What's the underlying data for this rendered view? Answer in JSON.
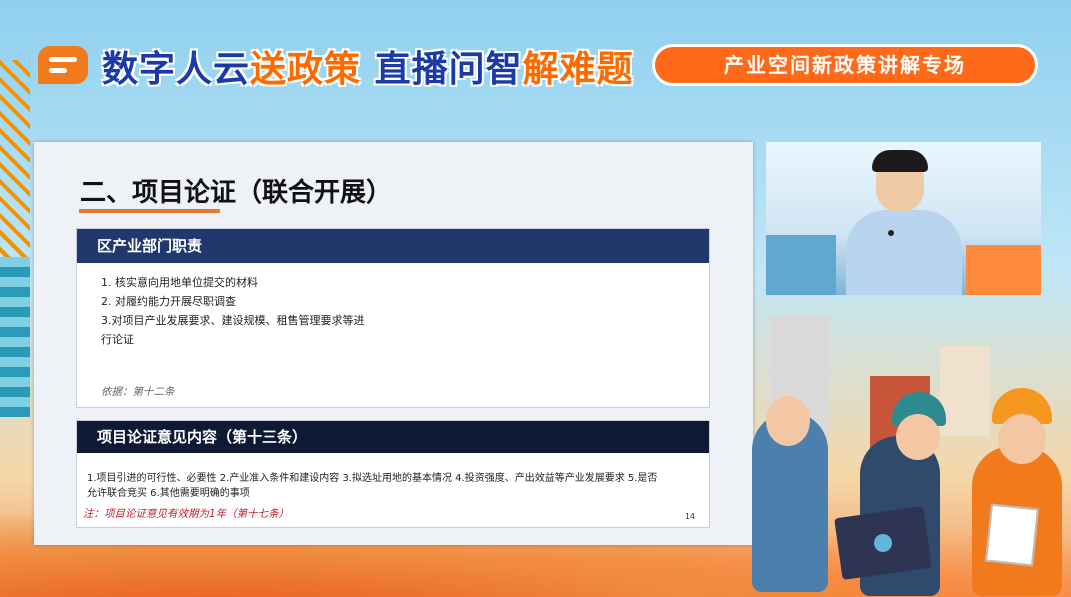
{
  "header": {
    "title_part1": "数字人云",
    "title_part2": "送政策",
    "title_part3": " 直播问智",
    "title_part4": "解难题",
    "pill_label": "产业空间新政策讲解专场"
  },
  "slide": {
    "title": "二、项目论证（联合开展）",
    "section1": {
      "heading": "区产业部门职责",
      "items": [
        "1. 核实意向用地单位提交的材料",
        "2. 对履约能力开展尽职调查",
        "3.对项目产业发展要求、建设规模、租售管理要求等进",
        "行论证"
      ],
      "basis": "依据：第十二条"
    },
    "section2": {
      "heading": "项目论证意见内容（第十三条）",
      "content_line1": "1.项目引进的可行性、必要性  2.产业准入条件和建设内容  3.拟选址用地的基本情况  4.投资强度、产出效益等产业发展要求  5.是否",
      "content_line2": "允许联合竞买  6.其他需要明确的事项",
      "note": "注：项目论证意见有效期为1年（第十七条）",
      "page_number": "14"
    }
  },
  "colors": {
    "brand_blue": "#1a3aa8",
    "brand_orange": "#ff6a00",
    "section_header": "#21386c",
    "note_red": "#c0202a"
  }
}
